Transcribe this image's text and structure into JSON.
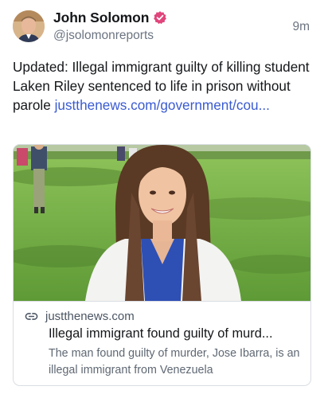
{
  "author": {
    "display_name": "John Solomon",
    "handle": "@jsolomonreports",
    "avatar_icon": "avatar-photo",
    "verified_icon": "verified-badge-icon",
    "verified_color": "#e0457b"
  },
  "post": {
    "timestamp": "9m",
    "text": "Updated: Illegal immigrant guilty of killing student Laken Riley sentenced to life in prison without parole ",
    "link_text": "justthenews.com/government/cou..."
  },
  "link_card": {
    "image_icon": "article-photo",
    "link_icon": "link-icon",
    "domain": "justthenews.com",
    "title": "Illegal immigrant found guilty of murd...",
    "description": "The man found guilty of murder, Jose Ibarra, is an illegal immigrant from Venezuela"
  },
  "colors": {
    "text": "#15171a",
    "muted": "#6b7480",
    "link": "#3a5bd1",
    "border": "#d9dde3"
  }
}
